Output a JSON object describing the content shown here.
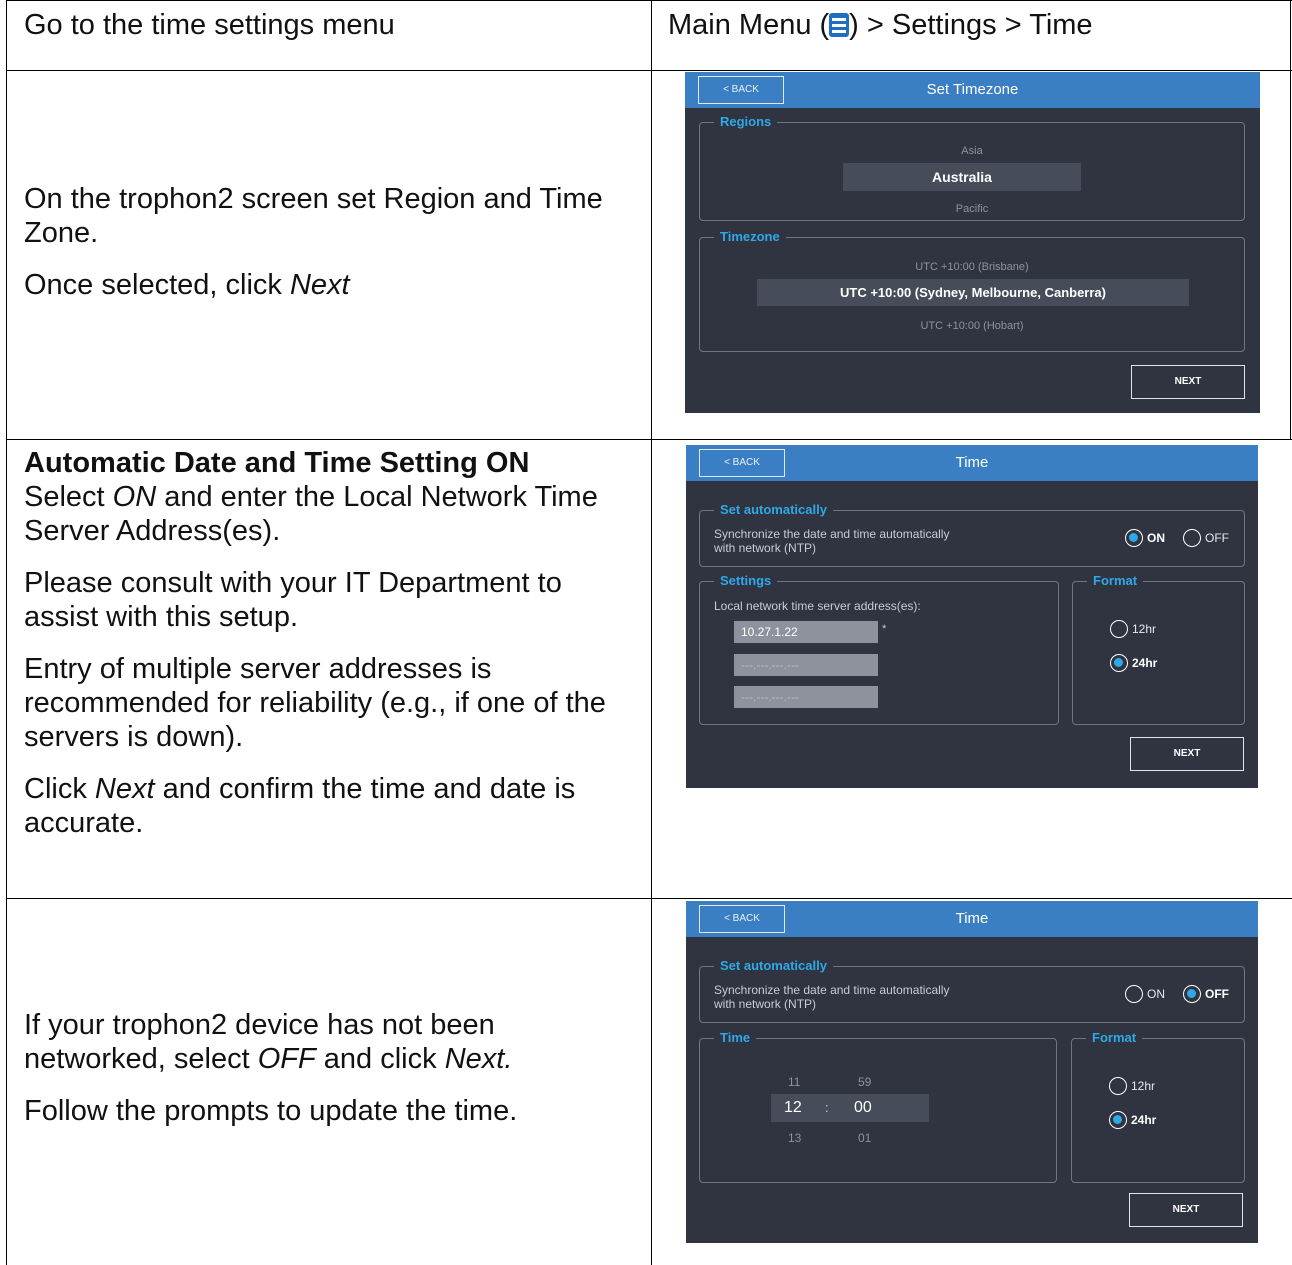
{
  "rows": [
    {
      "left_text": "Go to the time settings menu",
      "right_text_prefix": "Main Menu (",
      "right_text_suffix": ") > Settings > Time",
      "menu_icon": "hamburger-menu-icon"
    },
    {
      "paragraphs": [
        "On the trophon2 screen set Region and Time Zone.",
        "Once selected, click "
      ],
      "next_word": "Next",
      "screen": {
        "back": "< BACK",
        "title": "Set Timezone",
        "regions_legend": "Regions",
        "regions": [
          "Asia",
          "Australia",
          "Pacific"
        ],
        "timezone_legend": "Timezone",
        "timezones": [
          "UTC +10:00 (Brisbane)",
          "UTC +10:00 (Sydney, Melbourne, Canberra)",
          "UTC +10:00 (Hobart)"
        ],
        "next": "NEXT"
      }
    },
    {
      "heading": "Automatic Date and Time Setting ON",
      "p1_a": "Select ",
      "p1_em": "ON",
      "p1_b": " and enter the Local Network Time Server Address(es).",
      "p2": "Please consult with your IT Department to assist with this setup.",
      "p3": "Entry of multiple server addresses is recommended for reliability (e.g., if one of the servers is down).",
      "p4_a": "Click ",
      "p4_em": "Next",
      "p4_b": " and confirm the time and date is accurate.",
      "screen": {
        "back": "< BACK",
        "title": "Time",
        "auto_legend": "Set automatically",
        "auto_desc_1": "Synchronize the date and time automatically",
        "auto_desc_2": "with network (NTP)",
        "on": "ON",
        "off": "OFF",
        "settings_legend": "Settings",
        "server_label": "Local network time server address(es):",
        "servers": [
          "10.27.1.22",
          "---.---.---.---",
          "---.---.---.---"
        ],
        "asterisk": "*",
        "format_legend": "Format",
        "fmt12": "12hr",
        "fmt24": "24hr",
        "next": "NEXT"
      }
    },
    {
      "p1_a": "If your trophon2 device has not been networked, select ",
      "p1_em": "OFF",
      "p1_b": " and click ",
      "p1_em2": "Next.",
      "p2": "Follow the prompts to update the time.",
      "screen": {
        "back": "< BACK",
        "title": "Time",
        "auto_legend": "Set automatically",
        "auto_desc_1": "Synchronize the date and time automatically",
        "auto_desc_2": "with network (NTP)",
        "on": "ON",
        "off": "OFF",
        "time_legend": "Time",
        "hours": [
          "11",
          "12",
          "13"
        ],
        "minutes": [
          "59",
          "00",
          "01"
        ],
        "colon": ":",
        "format_legend": "Format",
        "fmt12": "12hr",
        "fmt24": "24hr",
        "next": "NEXT"
      }
    }
  ]
}
